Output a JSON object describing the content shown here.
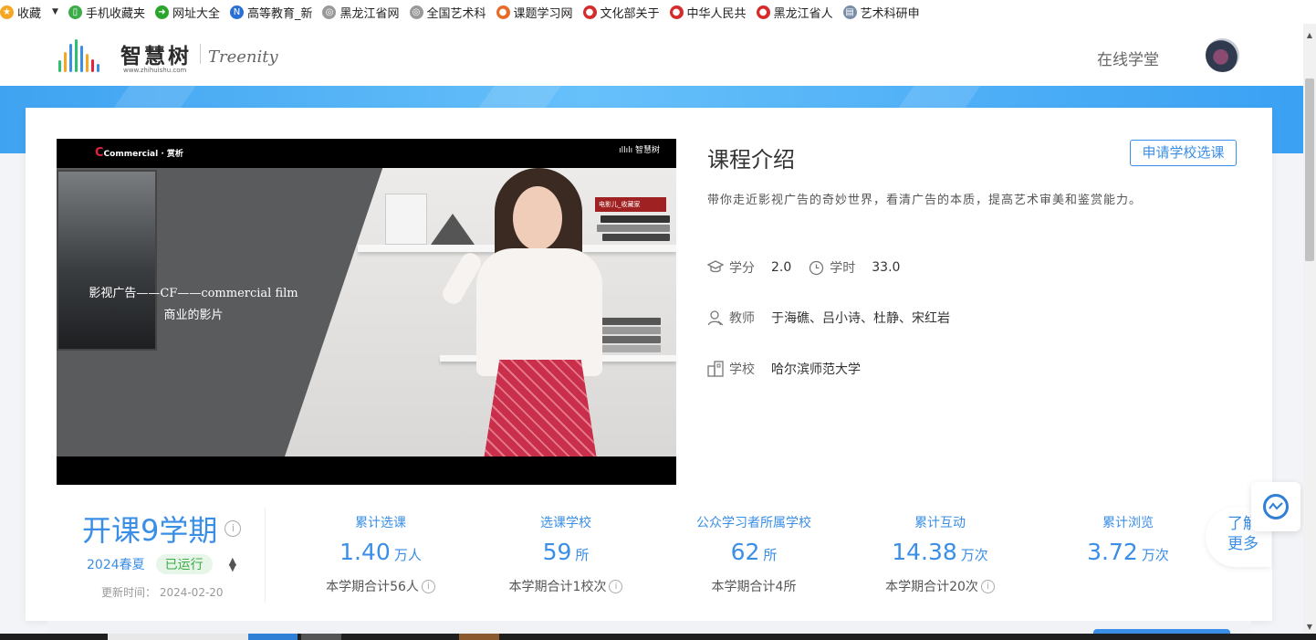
{
  "bookmarks": [
    {
      "label": "收藏",
      "icon": "star-icon",
      "color": "#f5a623",
      "glyph": "★"
    },
    {
      "label": "手机收藏夹",
      "icon": "phone-icon",
      "color": "#3cab48",
      "glyph": "▯"
    },
    {
      "label": "网址大全",
      "icon": "globe-arrow-icon",
      "color": "#2ca52c",
      "glyph": "➜"
    },
    {
      "label": "高等教育_新",
      "icon": "news-icon",
      "color": "#2a6fd6",
      "glyph": "N"
    },
    {
      "label": "黑龙江省网",
      "icon": "globe-icon",
      "color": "#999999",
      "glyph": "◎"
    },
    {
      "label": "全国艺术科",
      "icon": "globe-icon",
      "color": "#999999",
      "glyph": "◎"
    },
    {
      "label": "课题学习网",
      "icon": "fire-icon",
      "color": "#e86b28",
      "glyph": "●"
    },
    {
      "label": "文化部关于",
      "icon": "emblem-icon",
      "color": "#d62b2b",
      "glyph": "●"
    },
    {
      "label": "中华人民共",
      "icon": "emblem-icon",
      "color": "#d62b2b",
      "glyph": "●"
    },
    {
      "label": "黑龙江省人",
      "icon": "emblem-icon",
      "color": "#d62b2b",
      "glyph": "●"
    },
    {
      "label": "艺术科研申",
      "icon": "document-icon",
      "color": "#7a8da6",
      "glyph": "▤"
    }
  ],
  "header": {
    "logo_cn": "智慧树",
    "logo_url": "www.zhihuishu.com",
    "logo_en": "Treenity",
    "nav_link": "在线学堂",
    "bar_colors": [
      "#2fbf71",
      "#f5a623",
      "#3a8ee6",
      "#2fbf71",
      "#3a8ee6",
      "#f5a623",
      "#e5233f",
      "#3a8ee6"
    ],
    "bar_heights": [
      0.35,
      0.6,
      0.85,
      1.0,
      0.8,
      0.55,
      0.4,
      0.25
    ]
  },
  "video": {
    "top_left": "Commercial · 赏析",
    "top_left_c": "C",
    "top_right": "ıllılı 智慧树",
    "book_label": "电影儿_收藏家",
    "caption_line1": "影视广告——CF——commercial film",
    "caption_line2": "商业的影片"
  },
  "intro": {
    "title": "课程介绍",
    "apply_button": "申请学校选课",
    "description": "带你走近影视广告的奇妙世界，看清广告的本质，提高艺术审美和鉴赏能力。",
    "credit_label": "学分",
    "credit_value": "2.0",
    "hours_label": "学时",
    "hours_value": "33.0",
    "teacher_label": "教师",
    "teachers": "于海礁、吕小诗、杜静、宋红岩",
    "school_label": "学校",
    "school": "哈尔滨师范大学"
  },
  "summary": {
    "terms_title": "开课9学期",
    "info_glyph": "i",
    "term": "2024春夏",
    "status_badge": "已运行",
    "sort_glyph_up": "▲",
    "sort_glyph_down": "▼",
    "updated": "更新时间：  2024-02-20"
  },
  "stats": [
    {
      "label": "累计选课",
      "value": "1.40",
      "unit": "万人",
      "sub": "本学期合计56人",
      "info": true
    },
    {
      "label": "选课学校",
      "value": "59",
      "unit": "所",
      "sub": "本学期合计1校次",
      "info": true
    },
    {
      "label": "公众学习者所属学校",
      "value": "62",
      "unit": "所",
      "sub": "本学期合计4所",
      "info": false
    },
    {
      "label": "累计互动",
      "value": "14.38",
      "unit": "万次",
      "sub": "本学期合计20次",
      "info": true
    },
    {
      "label": "累计浏览",
      "value": "3.72",
      "unit": "万次",
      "sub": "",
      "info": false
    }
  ],
  "floating": {
    "learn_more_line1": "了解",
    "learn_more_line2": "更多"
  },
  "colors": {
    "accent": "#3a8ee6",
    "banner": "#4aaef5",
    "badge_green": "#3cab48"
  }
}
